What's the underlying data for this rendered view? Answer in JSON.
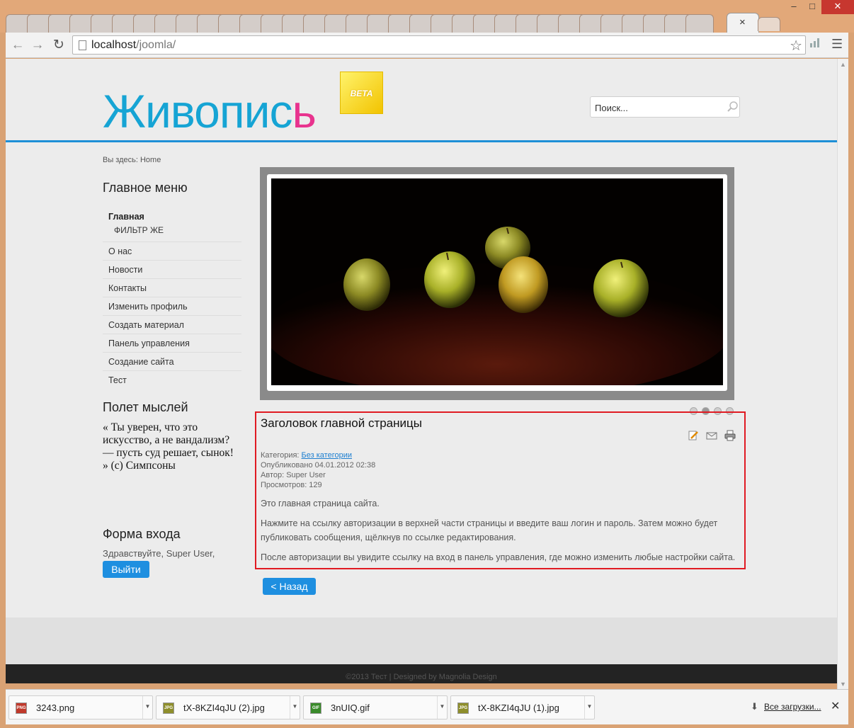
{
  "browser": {
    "window_buttons": {
      "minimize": "–",
      "maximize": "□",
      "close": "✕"
    },
    "tab_close": "×",
    "url_host": "localhost",
    "url_path": "/joomla/"
  },
  "site": {
    "logo_main": "Живопис",
    "logo_last": "ь",
    "beta": "BETA",
    "search_placeholder": "Поиск...",
    "breadcrumb": "Вы здесь: Home"
  },
  "sidebar": {
    "menu_title": "Главное меню",
    "menu_items": [
      "Главная",
      "ФИЛЬТР ЖЕ",
      "О нас",
      "Новости",
      "Контакты",
      "Изменить профиль",
      "Создать материал",
      "Панель управления",
      "Создание сайта",
      "Тест"
    ],
    "quote_title": "Полет мыслей",
    "quote_text": "« Ты уверен, что это искусство, а не вандализм? — пусть суд решает, сынок! » (с) Симпсоны",
    "login_title": "Форма входа",
    "login_greeting": "Здравствуйте, Super User,",
    "logout_label": "Выйти"
  },
  "article": {
    "title": "Заголовок главной страницы",
    "category_label": "Категория: ",
    "category_value": "Без категории",
    "published": "Опубликовано 04.01.2012 02:38",
    "author": "Автор: Super User",
    "views": "Просмотров: 129",
    "paragraphs": [
      "Это главная страница сайта.",
      "Нажмите на ссылку авторизации в верхней части страницы и введите ваш логин и пароль. Затем можно будет публиковать сообщения, щёлкнув по ссылке редактирования.",
      "После авторизации вы увидите ссылку на вход в панель управления, где можно изменить любые настройки сайта."
    ],
    "back_label": "< Назад"
  },
  "footer": {
    "text": "©2013 Тест | Designed by Magnolia Design"
  },
  "downloads": {
    "items": [
      {
        "name": "3243.png",
        "type": "PNG",
        "color": "#c0392b"
      },
      {
        "name": "tX-8KZI4qJU (2).jpg",
        "type": "JPG",
        "color": "#8e8e2b"
      },
      {
        "name": "3nUIQ.gif",
        "type": "GIF",
        "color": "#3a8a2b"
      },
      {
        "name": "tX-8KZI4qJU (1).jpg",
        "type": "JPG",
        "color": "#8e8e2b"
      }
    ],
    "all_label": "Все загрузки...",
    "close": "✕"
  },
  "colors": {
    "accent_blue": "#1e8fd7",
    "logo_pink": "#e8338e",
    "highlight_red": "#e01a22"
  }
}
